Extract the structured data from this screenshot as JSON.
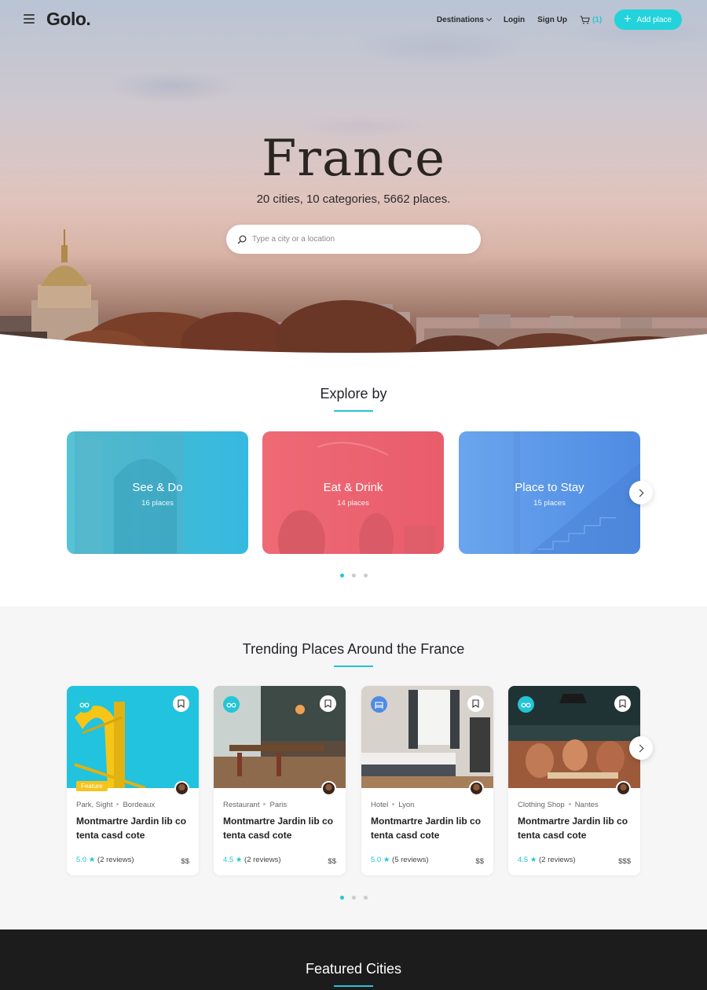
{
  "header": {
    "logo": "Golo.",
    "nav": {
      "destinations": "Destinations",
      "login": "Login",
      "signup": "Sign Up",
      "cart_count": "(1)",
      "add_place": "Add place"
    }
  },
  "hero": {
    "title": "France",
    "subtitle": "20 cities, 10 categories, 5662 places.",
    "search_placeholder": "Type a city or a location"
  },
  "explore": {
    "title": "Explore by",
    "cards": [
      {
        "name": "See & Do",
        "count": "16 places"
      },
      {
        "name": "Eat & Drink",
        "count": "14 places"
      },
      {
        "name": "Place to Stay",
        "count": "15 places"
      }
    ],
    "pagination": {
      "pages": 3,
      "active": 1
    }
  },
  "trending": {
    "title": "Trending Places Around the France",
    "places": [
      {
        "category": "Park, Sight",
        "city": "Bordeaux",
        "name": "Montmartre Jardin lib co tenta casd cote",
        "score": "5.0",
        "reviews": "(2 reviews)",
        "price": "$$",
        "feature": "Feature",
        "icon": "binoculars-icon"
      },
      {
        "category": "Restaurant",
        "city": "Paris",
        "name": "Montmartre Jardin lib co tenta casd cote",
        "score": "4.5",
        "reviews": "(2 reviews)",
        "price": "$$",
        "icon": "binoculars-icon"
      },
      {
        "category": "Hotel",
        "city": "Lyon",
        "name": "Montmartre Jardin lib co tenta casd cote",
        "score": "5.0",
        "reviews": "(5 reviews)",
        "price": "$$",
        "icon": "bed-icon"
      },
      {
        "category": "Clothing Shop",
        "city": "Nantes",
        "name": "Montmartre Jardin lib co tenta casd cote",
        "score": "4.5",
        "reviews": "(2 reviews)",
        "price": "$$$",
        "icon": "binoculars-icon"
      }
    ],
    "pagination": {
      "pages": 3,
      "active": 1
    }
  },
  "featured": {
    "title": "Featured Cities"
  },
  "colors": {
    "accent": "#23c5d6",
    "feature_tag": "#f6c31b",
    "see_do": "#3fbad8",
    "eat_drink": "#e95c6c",
    "stay": "#4f8be2",
    "footer_bg": "#1c1c1c"
  }
}
